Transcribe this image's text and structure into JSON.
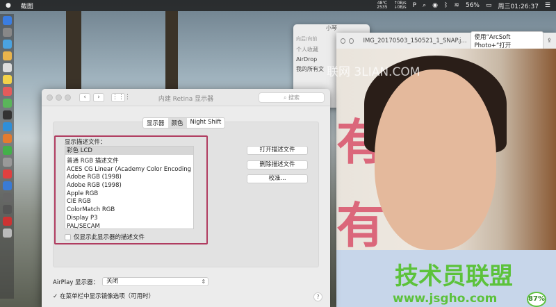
{
  "menubar": {
    "app": "截图",
    "temp": "48℃",
    "fan": "2535",
    "net_up": "↑0B/s",
    "net_down": "↓0B/s",
    "battery": "56%",
    "clock": "周三01:26:37"
  },
  "finder": {
    "title": "小琴",
    "nav_label": "向后/向前",
    "section": "个人收藏",
    "items": [
      "AirDrop",
      "我的所有文"
    ]
  },
  "quicklook": {
    "filename": "IMG_20170503_150521_1_SNAP.j...",
    "open_with": "使用“ArcSoft Photo+”打开"
  },
  "watermarks": {
    "top": "联网 3LIAN.COM",
    "brand": "技术员联盟",
    "url": "www.jsgho.com",
    "badge": "87%"
  },
  "prefs": {
    "title": "内建 Retina 显示器",
    "search_placeholder": "搜索",
    "tabs": [
      {
        "label": "显示器",
        "selected": false
      },
      {
        "label": "颜色",
        "selected": true
      },
      {
        "label": "Night Shift",
        "selected": false
      }
    ],
    "profile_label": "显示描述文件：",
    "selected_profile": "彩色 LCD",
    "profiles": [
      "普通 RGB 描述文件",
      "ACES CG Linear (Academy Color Encoding Sy...",
      "Adobe RGB (1998)",
      "Adobe RGB (1998)",
      "Apple RGB",
      "CIE RGB",
      "ColorMatch RGB",
      "Display P3",
      "PAL/SECAM"
    ],
    "only_this_display": "仅显示此显示器的描述文件",
    "buttons": {
      "open": "打开描述文件",
      "delete": "删除描述文件",
      "calibrate": "校准..."
    },
    "airplay_label": "AirPlay 显示器：",
    "airplay_value": "关闭",
    "mirror_option": "在菜单栏中显示镜像选项（可用时）",
    "mirror_checked": true,
    "help": "?"
  },
  "colors": {
    "highlight_box": "#b03c60",
    "menubar": "#1e1e1e"
  }
}
